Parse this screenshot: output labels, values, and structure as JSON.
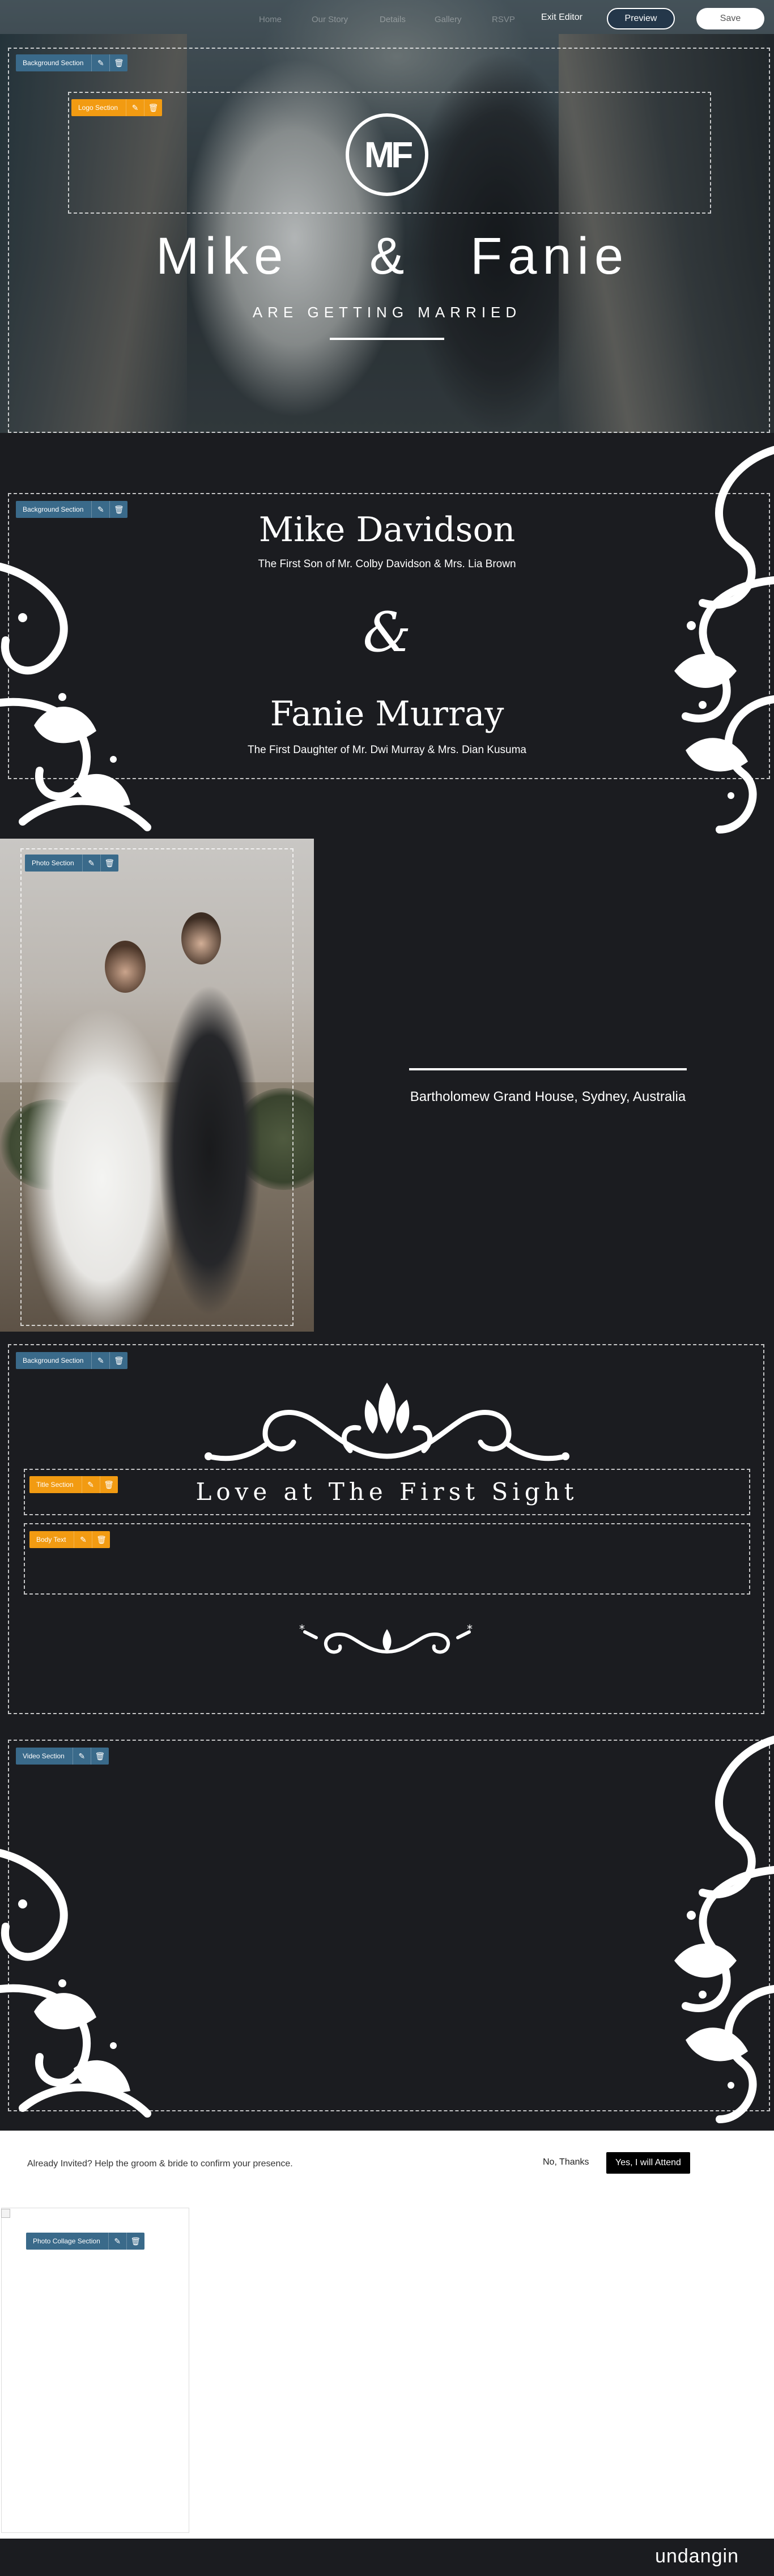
{
  "nav": {
    "links": [
      "Home",
      "Our Story",
      "Details",
      "Gallery",
      "RSVP"
    ],
    "exit_label": "Exit Editor",
    "preview_label": "Preview",
    "save_label": "Save"
  },
  "hero": {
    "monogram": "MF",
    "groom_first": "Mike",
    "ampersand": "&",
    "bride_first": "Fanie",
    "tagline": "ARE GETTING MARRIED"
  },
  "badges": {
    "background_section": "Background Section",
    "logo_section": "Logo Section",
    "photo_section": "Photo Section",
    "title_section": "Title Section",
    "body_text": "Body Text",
    "video_section": "Video Section",
    "photo_collage_section": "Photo Collage Section"
  },
  "couple": {
    "groom_name": "Mike Davidson",
    "groom_sub": "The First Son of Mr. Colby Davidson & Mrs. Lia Brown",
    "ampersand": "&",
    "bride_name": "Fanie Murray",
    "bride_sub": "The First Daughter of Mr. Dwi Murray & Mrs. Dian Kusuma"
  },
  "venue": {
    "text": "Bartholomew Grand House, Sydney, Australia"
  },
  "story": {
    "title": "Love at The First Sight"
  },
  "rsvp": {
    "message": "Already Invited? Help the groom & bride to confirm your presence.",
    "no_label": "No, Thanks",
    "yes_label": "Yes, I will Attend"
  },
  "footer": {
    "brand": "undangin"
  },
  "colors": {
    "page_bg": "#1b1c20",
    "badge_blue": "#3a6a8a",
    "badge_orange": "#f29b12"
  }
}
